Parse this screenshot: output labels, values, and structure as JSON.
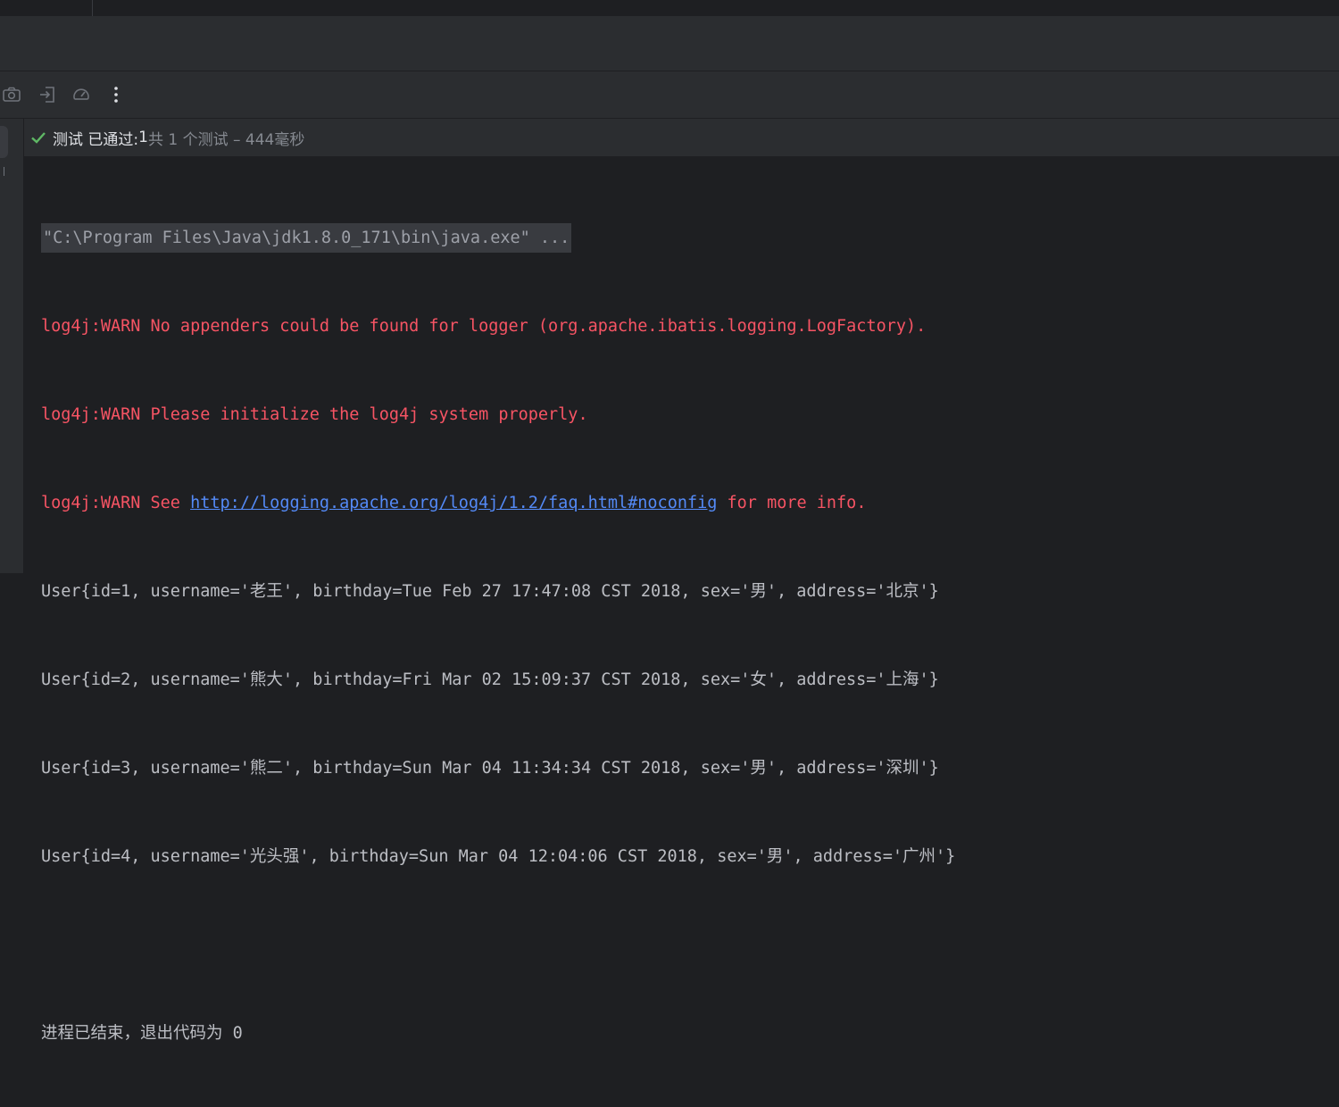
{
  "toolbar": {
    "icons": [
      "camera-icon",
      "import-icon",
      "speedometer-icon",
      "more-vertical-icon"
    ]
  },
  "status": {
    "passed_label": "测试 已通过: ",
    "passed_count": "1",
    "summary": "共 1 个测试 – 444毫秒"
  },
  "console": {
    "command": "\"C:\\Program Files\\Java\\jdk1.8.0_171\\bin\\java.exe\" ...",
    "warn1": "log4j:WARN No appenders could be found for logger (org.apache.ibatis.logging.LogFactory).",
    "warn2": "log4j:WARN Please initialize the log4j system properly.",
    "warn3_prefix": "log4j:WARN See ",
    "warn3_link": "http://logging.apache.org/log4j/1.2/faq.html#noconfig",
    "warn3_suffix": " for more info.",
    "users": [
      "User{id=1, username='老王', birthday=Tue Feb 27 17:47:08 CST 2018, sex='男', address='北京'}",
      "User{id=2, username='熊大', birthday=Fri Mar 02 15:09:37 CST 2018, sex='女', address='上海'}",
      "User{id=3, username='熊二', birthday=Sun Mar 04 11:34:34 CST 2018, sex='男', address='深圳'}",
      "User{id=4, username='光头强', birthday=Sun Mar 04 12:04:06 CST 2018, sex='男', address='广州'}"
    ],
    "exit_message": "进程已结束，退出代码为 0"
  },
  "colors": {
    "background": "#1e1f22",
    "panel": "#2b2d30",
    "warn": "#f75464",
    "link": "#548af7",
    "pass": "#5fb865"
  }
}
